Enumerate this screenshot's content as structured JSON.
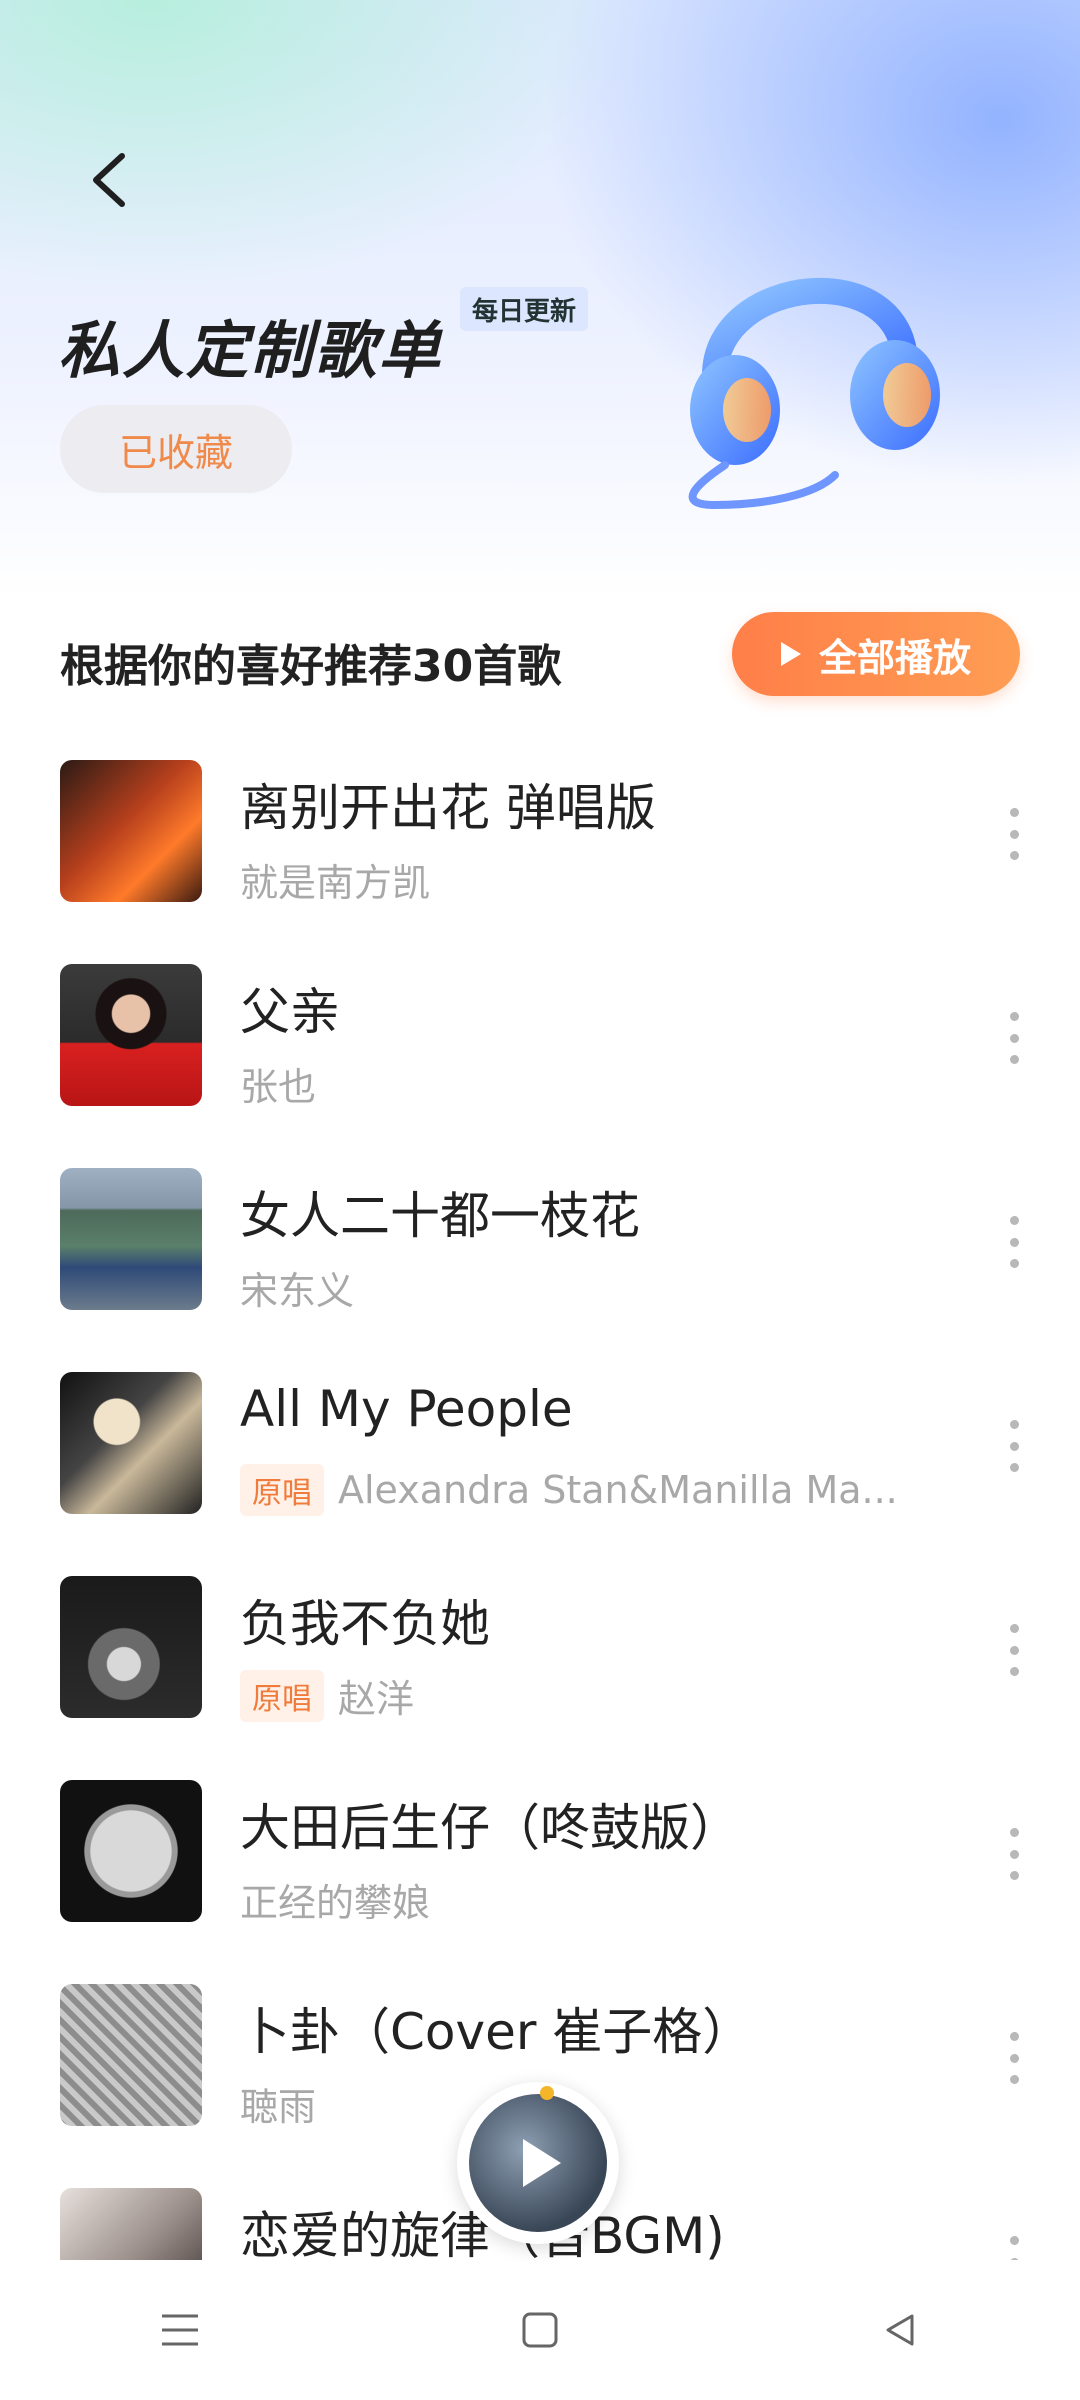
{
  "header": {
    "title": "私人定制歌单",
    "daily_badge": "每日更新",
    "collected_label": "已收藏"
  },
  "recommend": {
    "title": "根据你的喜好推荐30首歌",
    "play_all_label": "全部播放"
  },
  "songs": [
    {
      "title": "离别开出花 弹唱版",
      "artist": "就是南方凯",
      "badge": ""
    },
    {
      "title": "父亲",
      "artist": "张也",
      "badge": ""
    },
    {
      "title": "女人二十都一枝花",
      "artist": "宋东义",
      "badge": ""
    },
    {
      "title": "All My People",
      "artist": "Alexandra Stan&Manilla Ma...",
      "badge": "原唱"
    },
    {
      "title": "负我不负她",
      "artist": "赵洋",
      "badge": "原唱"
    },
    {
      "title": "大田后生仔（咚鼓版）",
      "artist": "正经的攀娘",
      "badge": ""
    },
    {
      "title": "卜卦（Cover 崔子格）",
      "artist": "聴雨",
      "badge": ""
    },
    {
      "title": "恋爱的旋律（音BGM)",
      "artist": "",
      "badge": ""
    }
  ],
  "colors": {
    "accent": "#ff8a4c",
    "badge_bg": "#fff0e8",
    "badge_text": "#f07b3a"
  }
}
